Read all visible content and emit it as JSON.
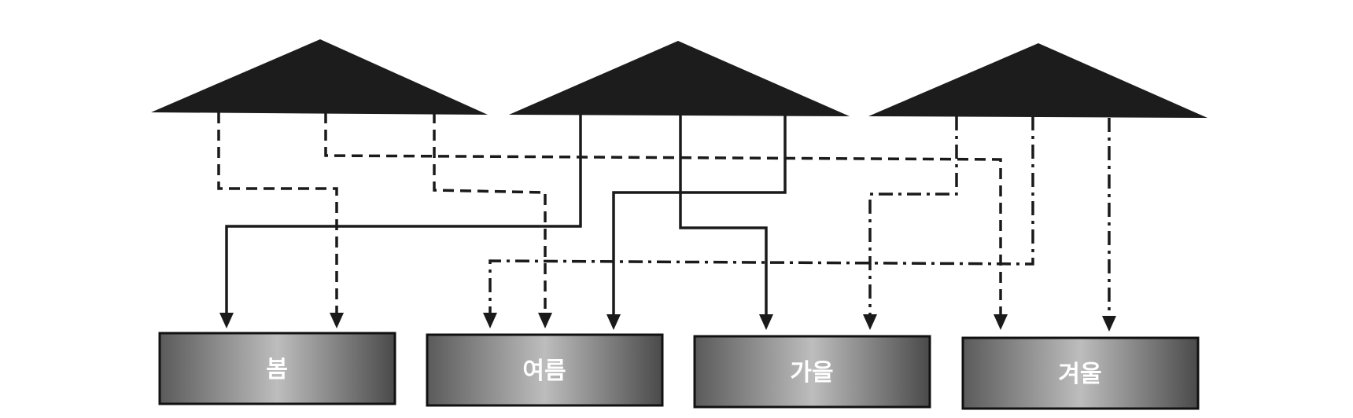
{
  "seasons": [
    "봄",
    "여름",
    "가을",
    "겨울"
  ]
}
